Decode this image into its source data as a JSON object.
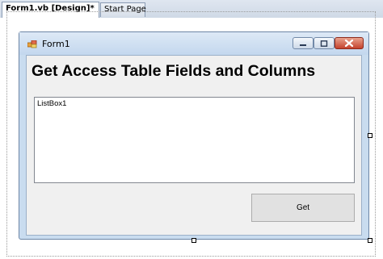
{
  "tabs": [
    {
      "label": "Form1.vb [Design]*",
      "active": true
    },
    {
      "label": "Start Page",
      "active": false
    }
  ],
  "form": {
    "title": "Form1",
    "heading": "Get Access Table Fields and Columns",
    "listbox_label": "ListBox1",
    "get_button_label": "Get"
  },
  "colors": {
    "close_button": "#c4422d",
    "title_bar": "#c9dcef",
    "client_area": "#f0f0f0"
  }
}
